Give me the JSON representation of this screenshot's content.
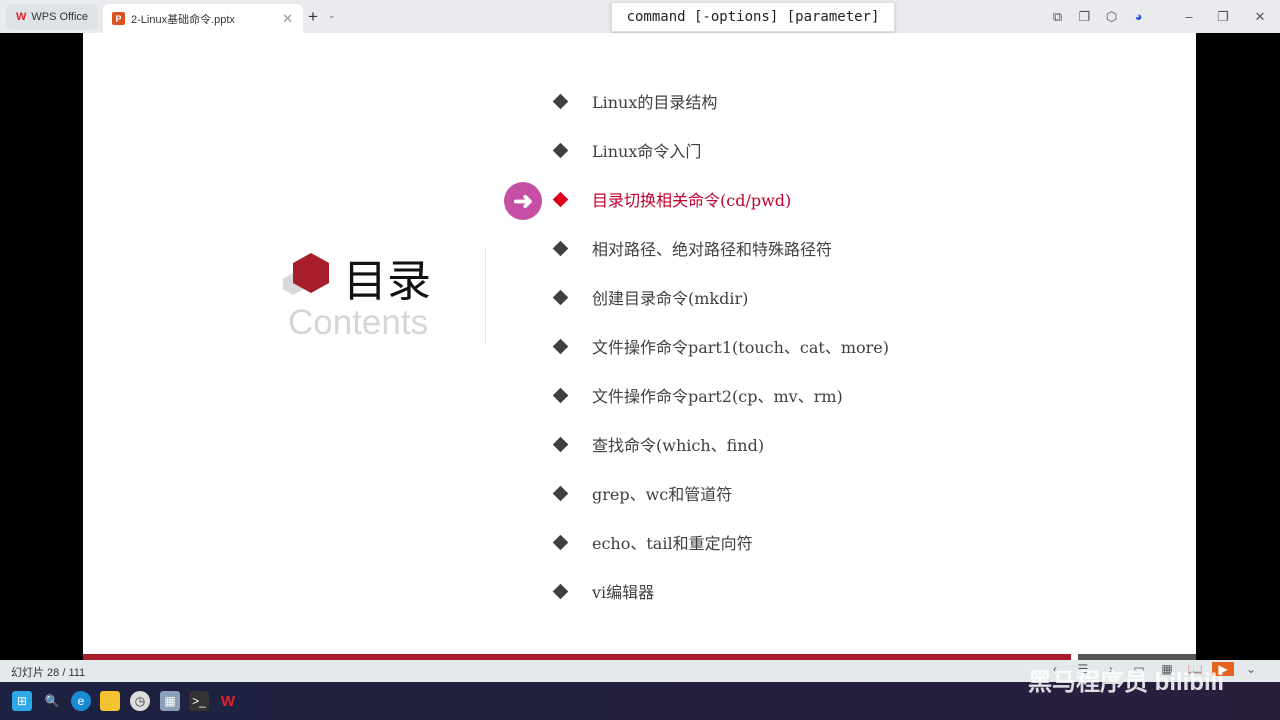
{
  "titlebar": {
    "home_tab": "WPS Office",
    "doc_tab": "2-Linux基础命令.pptx",
    "doc_icon": "P",
    "new_tab": "+"
  },
  "tooltip": "command [-options] [parameter]",
  "slide": {
    "title": "目录",
    "subtitle": "Contents",
    "items": [
      {
        "label": "Linux的目录结构"
      },
      {
        "label": "Linux命令入门"
      },
      {
        "label": "目录切换相关命令(cd/pwd)",
        "active": true
      },
      {
        "label": "相对路径、绝对路径和特殊路径符"
      },
      {
        "label": "创建目录命令(mkdir)"
      },
      {
        "label": "文件操作命令part1(touch、cat、more)"
      },
      {
        "label": "文件操作命令part2(cp、mv、rm)"
      },
      {
        "label": "查找命令(which、find)"
      },
      {
        "label": "grep、wc和管道符"
      },
      {
        "label": "echo、tail和重定向符"
      },
      {
        "label": "vi编辑器"
      }
    ],
    "accent": "#a71d2a",
    "active_color": "#c0002a"
  },
  "status": {
    "slide_counter": "幻灯片 28 / 111"
  },
  "watermark": "黑马程序员 bilibili"
}
